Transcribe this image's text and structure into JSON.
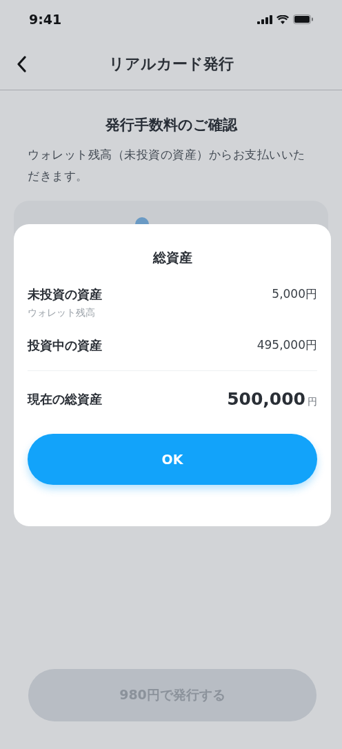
{
  "status_bar": {
    "time": "9:41"
  },
  "nav": {
    "title": "リアルカード発行"
  },
  "heading": "発行手数料のご確認",
  "description": "ウォレット残高（未投資の資産）からお支払いいただきます。",
  "issue_button": {
    "label": "980円で発行する",
    "disabled": true
  },
  "modal": {
    "title": "総資産",
    "rows": [
      {
        "label": "未投資の資産",
        "sublabel": "ウォレット残高",
        "value": "5,000円"
      },
      {
        "label": "投資中の資産",
        "value": "495,000円"
      }
    ],
    "total": {
      "label": "現在の総資産",
      "amount": "500,000",
      "unit": "円"
    },
    "button": "OK"
  }
}
